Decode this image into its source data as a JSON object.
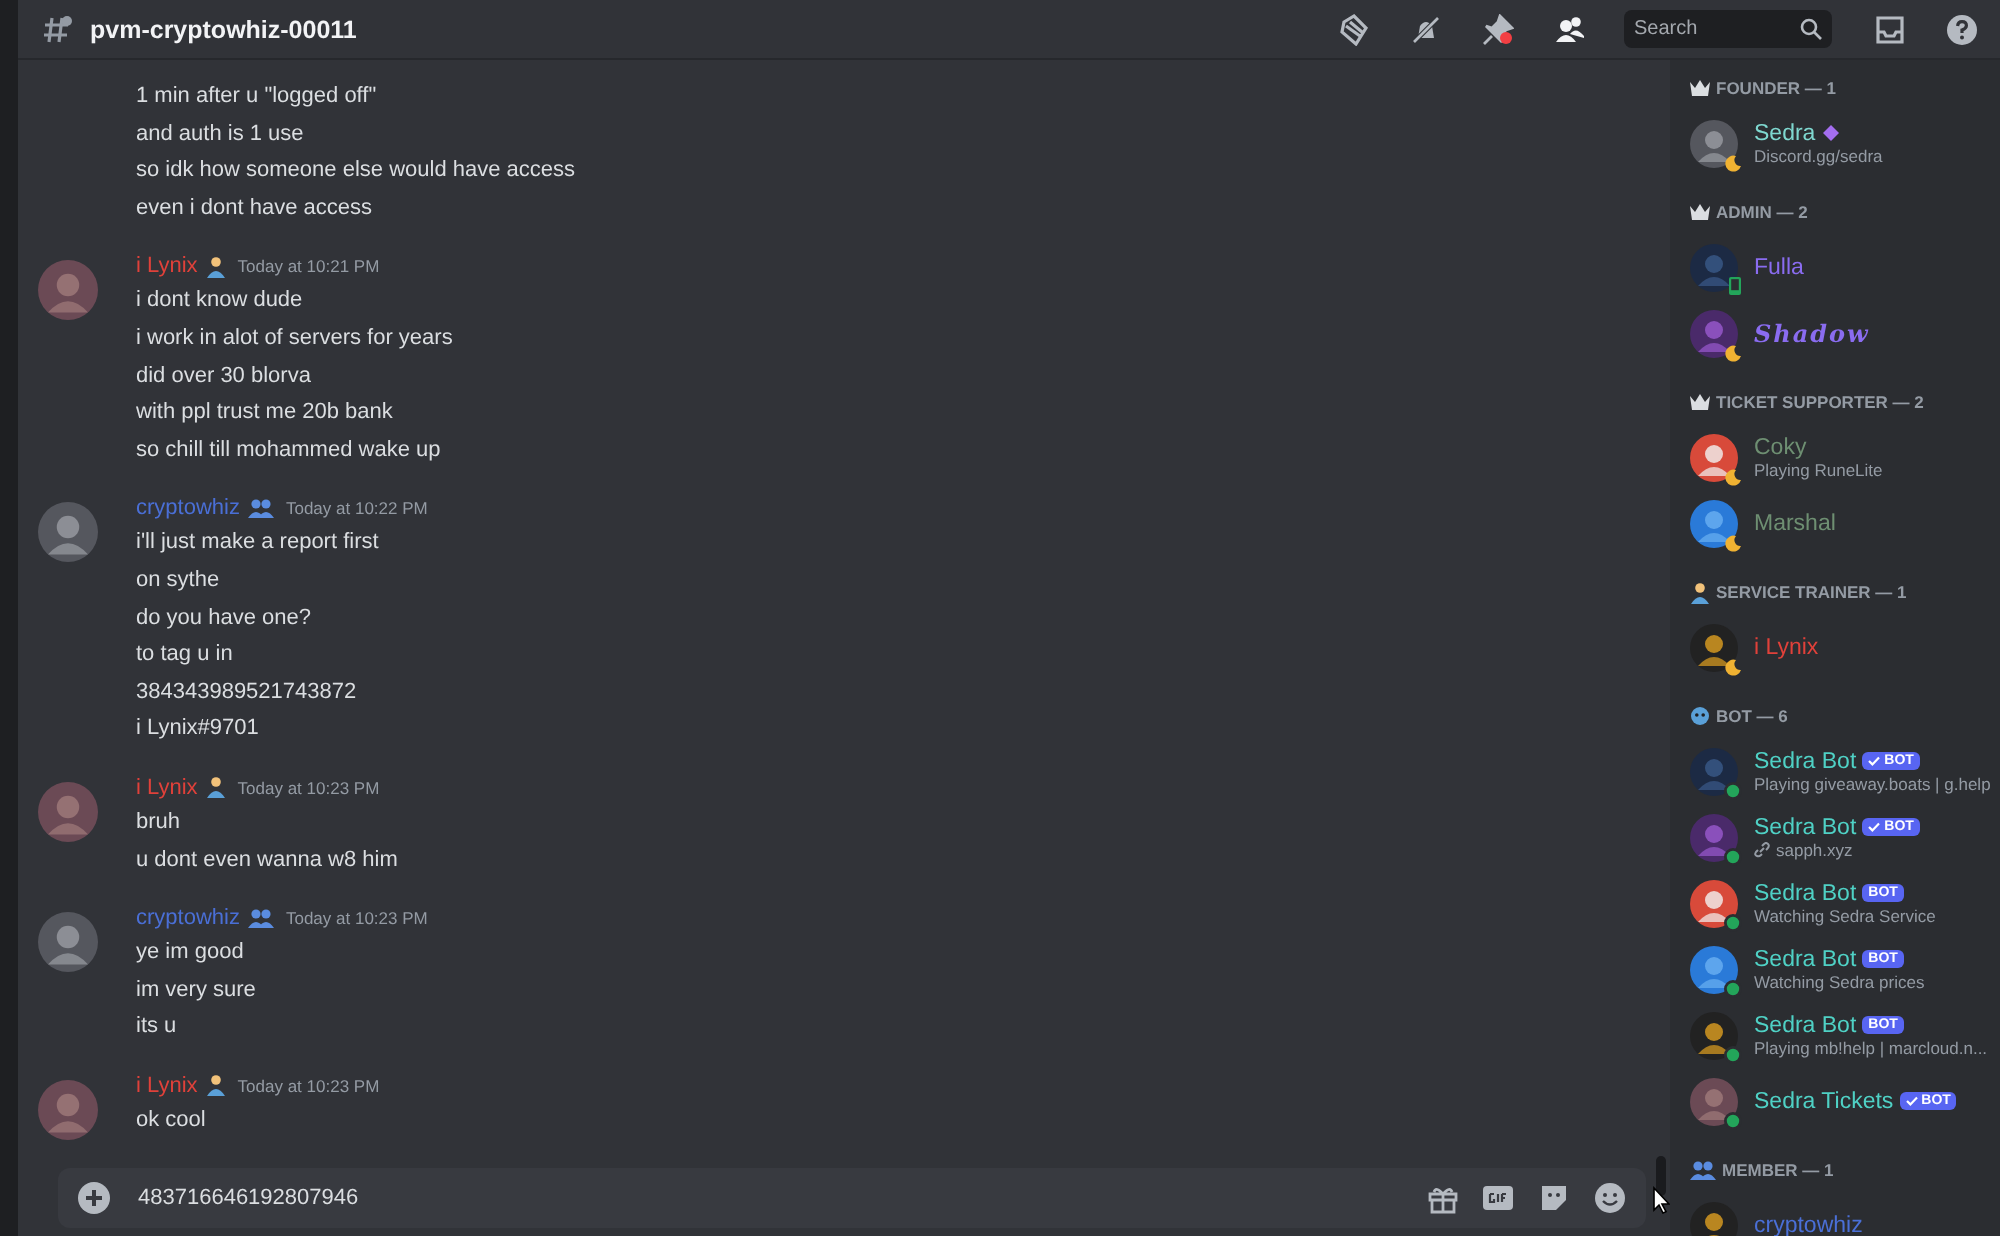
{
  "channel": {
    "name": "pvm-cryptowhiz-00011"
  },
  "search": {
    "placeholder": "Search"
  },
  "messages": [
    {
      "lines": [
        "1 min after u \"logged off\"",
        "and auth is 1 use",
        "so idk how someone else would have access",
        "even i dont have access"
      ]
    },
    {
      "author": "i Lynix",
      "color": "#e0413a",
      "kind": "staff",
      "time": "Today at 10:21 PM",
      "lines": [
        "i dont know dude",
        "i work in alot of servers for years",
        "did over 30 blorva",
        "with ppl trust me 20b bank",
        "so chill till mohammed wake up"
      ]
    },
    {
      "author": "cryptowhiz",
      "color": "#4a6fd6",
      "kind": "member",
      "time": "Today at 10:22 PM",
      "lines": [
        "i'll just make a report first",
        "on sythe",
        "do you have one?",
        "to tag u in",
        "384343989521743872",
        "i Lynix#9701"
      ]
    },
    {
      "author": "i Lynix",
      "color": "#e0413a",
      "kind": "staff",
      "time": "Today at 10:23 PM",
      "lines": [
        "bruh",
        "u dont even wanna w8 him"
      ]
    },
    {
      "author": "cryptowhiz",
      "color": "#4a6fd6",
      "kind": "member",
      "time": "Today at 10:23 PM",
      "lines": [
        "ye im good",
        "im very sure",
        "its u"
      ]
    },
    {
      "author": "i Lynix",
      "color": "#e0413a",
      "kind": "staff",
      "time": "Today at 10:23 PM",
      "lines": [
        "ok cool"
      ]
    }
  ],
  "composer": {
    "value": "483716646192807946"
  },
  "member_groups": [
    {
      "title": "FOUNDER — 1",
      "kind": "crown",
      "members": [
        {
          "name": "Sedra",
          "color": "#7fd8d0",
          "idle": true,
          "activity": "Discord.gg/sedra",
          "boost": true
        }
      ]
    },
    {
      "title": "ADMIN — 2",
      "kind": "crown",
      "members": [
        {
          "name": "Fulla",
          "color": "#8a6cf0",
          "mobile": true
        },
        {
          "name": "Shadow",
          "color": "#8a6cf0",
          "idle": true,
          "fancy": true
        }
      ]
    },
    {
      "title": "TICKET SUPPORTER — 2",
      "kind": "crown",
      "members": [
        {
          "name": "Coky",
          "color": "#6e8f72",
          "idle": true,
          "activity": "Playing RuneLite"
        },
        {
          "name": "Marshal",
          "color": "#6e8f72",
          "idle": true
        }
      ]
    },
    {
      "title": "SERVICE TRAINER — 1",
      "kind": "trainer",
      "members": [
        {
          "name": "i Lynix",
          "color": "#e0413a",
          "idle": true
        }
      ]
    },
    {
      "title": "BOT — 6",
      "kind": "bot",
      "members": [
        {
          "name": "Sedra Bot",
          "color": "#4fd1c5",
          "online": true,
          "bot": "BOT",
          "verified": true,
          "activity": "Playing giveaway.boats | g.help"
        },
        {
          "name": "Sedra Bot",
          "color": "#4fd1c5",
          "online": true,
          "bot": "BOT",
          "verified": true,
          "activity": "sapph.xyz",
          "link": true
        },
        {
          "name": "Sedra Bot",
          "color": "#4fd1c5",
          "online": true,
          "bot": "BOT",
          "verified": false,
          "activity": "Watching Sedra Service"
        },
        {
          "name": "Sedra Bot",
          "color": "#4fd1c5",
          "online": true,
          "bot": "BOT",
          "verified": false,
          "activity": "Watching Sedra prices"
        },
        {
          "name": "Sedra Bot",
          "color": "#4fd1c5",
          "online": true,
          "bot": "BOT",
          "verified": false,
          "activity": "Playing mb!help | marcloud.n..."
        },
        {
          "name": "Sedra Tickets",
          "color": "#4fd1c5",
          "online": true,
          "bot": "BOT",
          "verified": true
        }
      ]
    },
    {
      "title": "MEMBER — 1",
      "kind": "member",
      "members": [
        {
          "name": "cryptowhiz",
          "color": "#4a6fd6"
        }
      ]
    }
  ]
}
